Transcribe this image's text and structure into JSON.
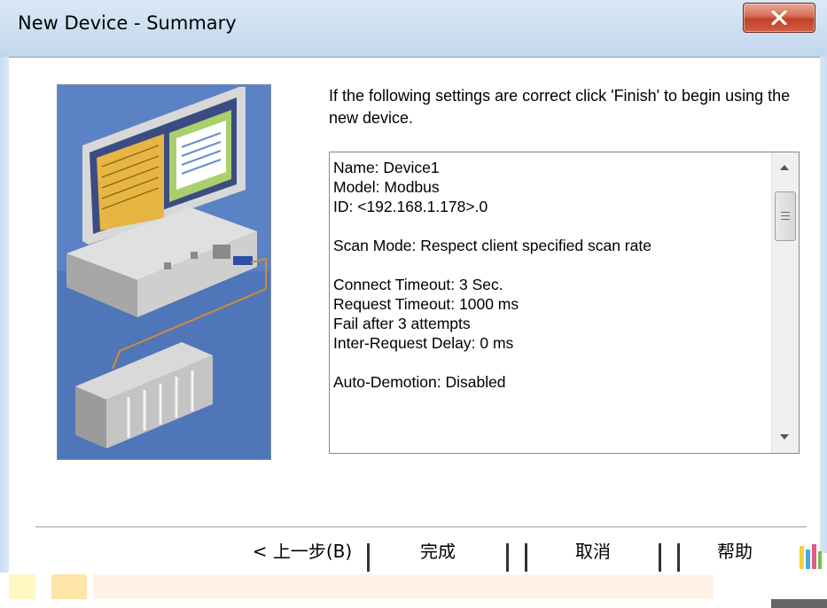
{
  "window": {
    "title": "New Device - Summary"
  },
  "instruction": "If the following settings are correct click 'Finish' to begin using the new device.",
  "summary": {
    "lines": "Name: Device1\nModel: Modbus\nID: <192.168.1.178>.0\n\nScan Mode: Respect client specified scan rate\n\nConnect Timeout: 3 Sec.\nRequest Timeout: 1000 ms\nFail after 3 attempts\nInter-Request Delay: 0 ms\n\nAuto-Demotion: Disabled"
  },
  "buttons": {
    "back": "< 上一步(B)",
    "finish": "完成",
    "cancel": "取消",
    "help": "帮助"
  },
  "colors": {
    "titlebar": "#cfe0f2",
    "close_button": "#c2412a",
    "illustration_bg": "#4f76b8"
  },
  "icons": {
    "close": "close-icon",
    "illustration": "computer-network-illustration",
    "corner": "color-bars-icon"
  }
}
